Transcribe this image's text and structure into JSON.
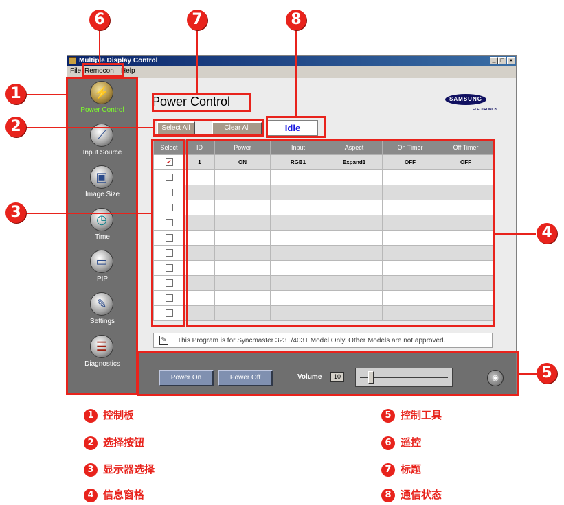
{
  "window": {
    "title": "Multiple Display Control",
    "buttons": [
      "_",
      "□",
      "×"
    ]
  },
  "menu": [
    "File",
    "Remocon",
    "Help"
  ],
  "sidebar": {
    "items": [
      {
        "label": "Power Control",
        "icon": "power-plug-icon",
        "active": true
      },
      {
        "label": "Input Source",
        "icon": "cable-icon"
      },
      {
        "label": "Image Size",
        "icon": "image-frame-icon"
      },
      {
        "label": "Time",
        "icon": "clock-icon"
      },
      {
        "label": "PIP",
        "icon": "pip-monitor-icon"
      },
      {
        "label": "Settings",
        "icon": "wrench-icon"
      },
      {
        "label": "Diagnostics",
        "icon": "clipboard-icon"
      }
    ]
  },
  "main": {
    "title": "Power Control",
    "brand": "SAMSUNG",
    "brand_sub": "ELECTRONICS",
    "select_all": "Select All",
    "clear_all": "Clear All",
    "status": "Idle",
    "table": {
      "headers": [
        "Select",
        "ID",
        "Power",
        "Input",
        "Aspect",
        "On Timer",
        "Off Timer"
      ],
      "rows": [
        {
          "checked": true,
          "id": "1",
          "power": "ON",
          "input": "RGB1",
          "aspect": "Expand1",
          "on_timer": "OFF",
          "off_timer": "OFF"
        },
        {
          "checked": false
        },
        {
          "checked": false
        },
        {
          "checked": false
        },
        {
          "checked": false
        },
        {
          "checked": false
        },
        {
          "checked": false
        },
        {
          "checked": false
        },
        {
          "checked": false
        },
        {
          "checked": false
        },
        {
          "checked": false
        }
      ]
    },
    "notice": "This Program is for Syncmaster 323T/403T Model Only. Other Models are not approved."
  },
  "bottom": {
    "power_on": "Power On",
    "power_off": "Power Off",
    "volume_label": "Volume",
    "volume_value": "10",
    "volume_level": 0.1
  },
  "callouts": [
    "1",
    "2",
    "3",
    "4",
    "5",
    "6",
    "7",
    "8"
  ],
  "legend": [
    {
      "num": "1",
      "text": "控制板"
    },
    {
      "num": "2",
      "text": "选择按钮"
    },
    {
      "num": "3",
      "text": "显示器选择"
    },
    {
      "num": "4",
      "text": "信息窗格"
    },
    {
      "num": "5",
      "text": "控制工具"
    },
    {
      "num": "6",
      "text": "遥控"
    },
    {
      "num": "7",
      "text": "标题"
    },
    {
      "num": "8",
      "text": "通信状态"
    }
  ],
  "colors": {
    "callout": "#e8231c",
    "active_label": "#7cff2a",
    "status_text": "#1a1ae0"
  }
}
